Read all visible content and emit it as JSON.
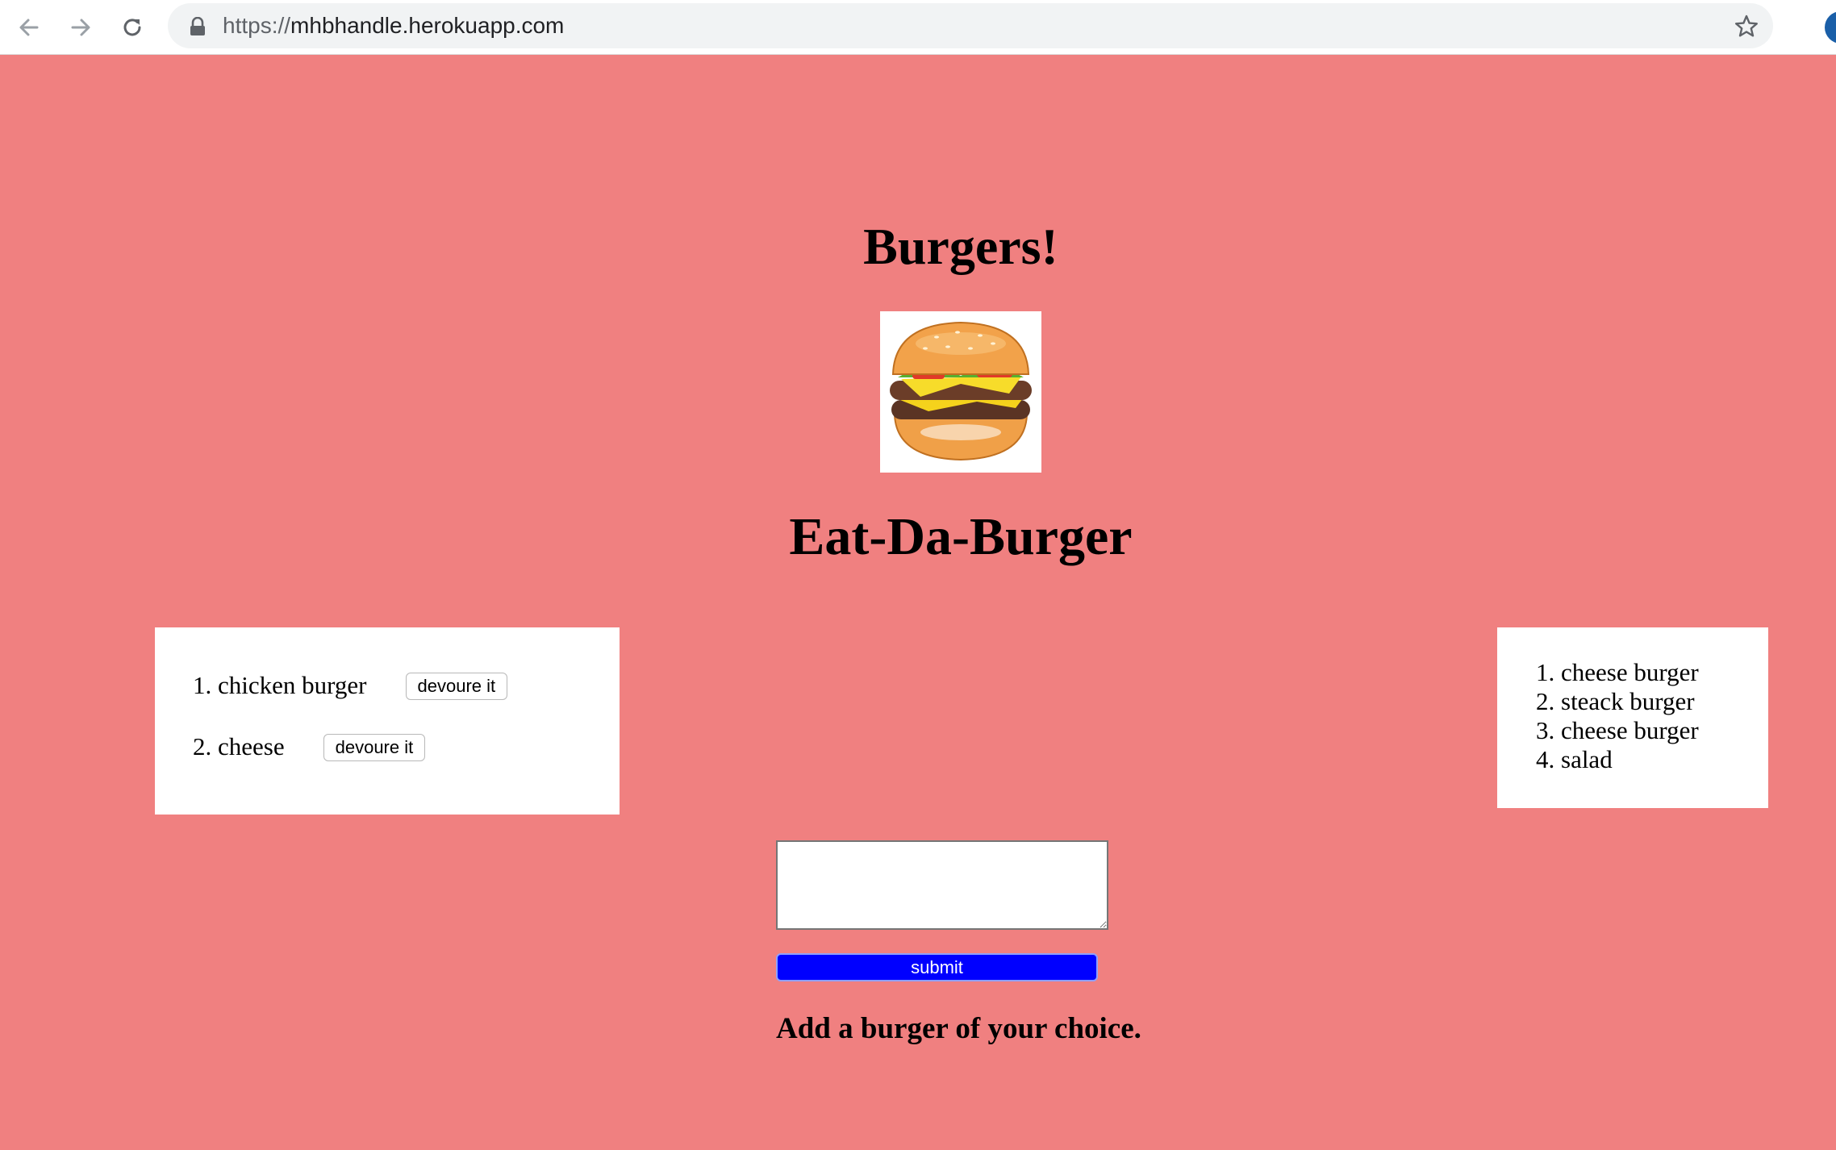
{
  "browser": {
    "url_scheme": "https://",
    "url_host": "mhbhandle.herokuapp.com",
    "icons": [
      "back-arrow-icon",
      "forward-arrow-icon",
      "reload-icon",
      "lock-icon",
      "star-icon"
    ]
  },
  "page": {
    "title": "Burgers!",
    "subtitle": "Eat-Da-Burger",
    "background_color": "#f08080",
    "submit_color": "#0000ff"
  },
  "uncooked": {
    "items": [
      {
        "number": "1.",
        "name": "chicken burger",
        "button": "devoure it"
      },
      {
        "number": "2.",
        "name": "cheese",
        "button": "devoure it"
      }
    ]
  },
  "devoured": {
    "items": [
      {
        "number": "1.",
        "name": "cheese burger"
      },
      {
        "number": "2.",
        "name": "steack burger"
      },
      {
        "number": "3.",
        "name": "cheese burger"
      },
      {
        "number": "4.",
        "name": "salad"
      }
    ]
  },
  "form": {
    "input_value": "",
    "submit_label": "submit",
    "hint": "Add a burger of your choice."
  }
}
